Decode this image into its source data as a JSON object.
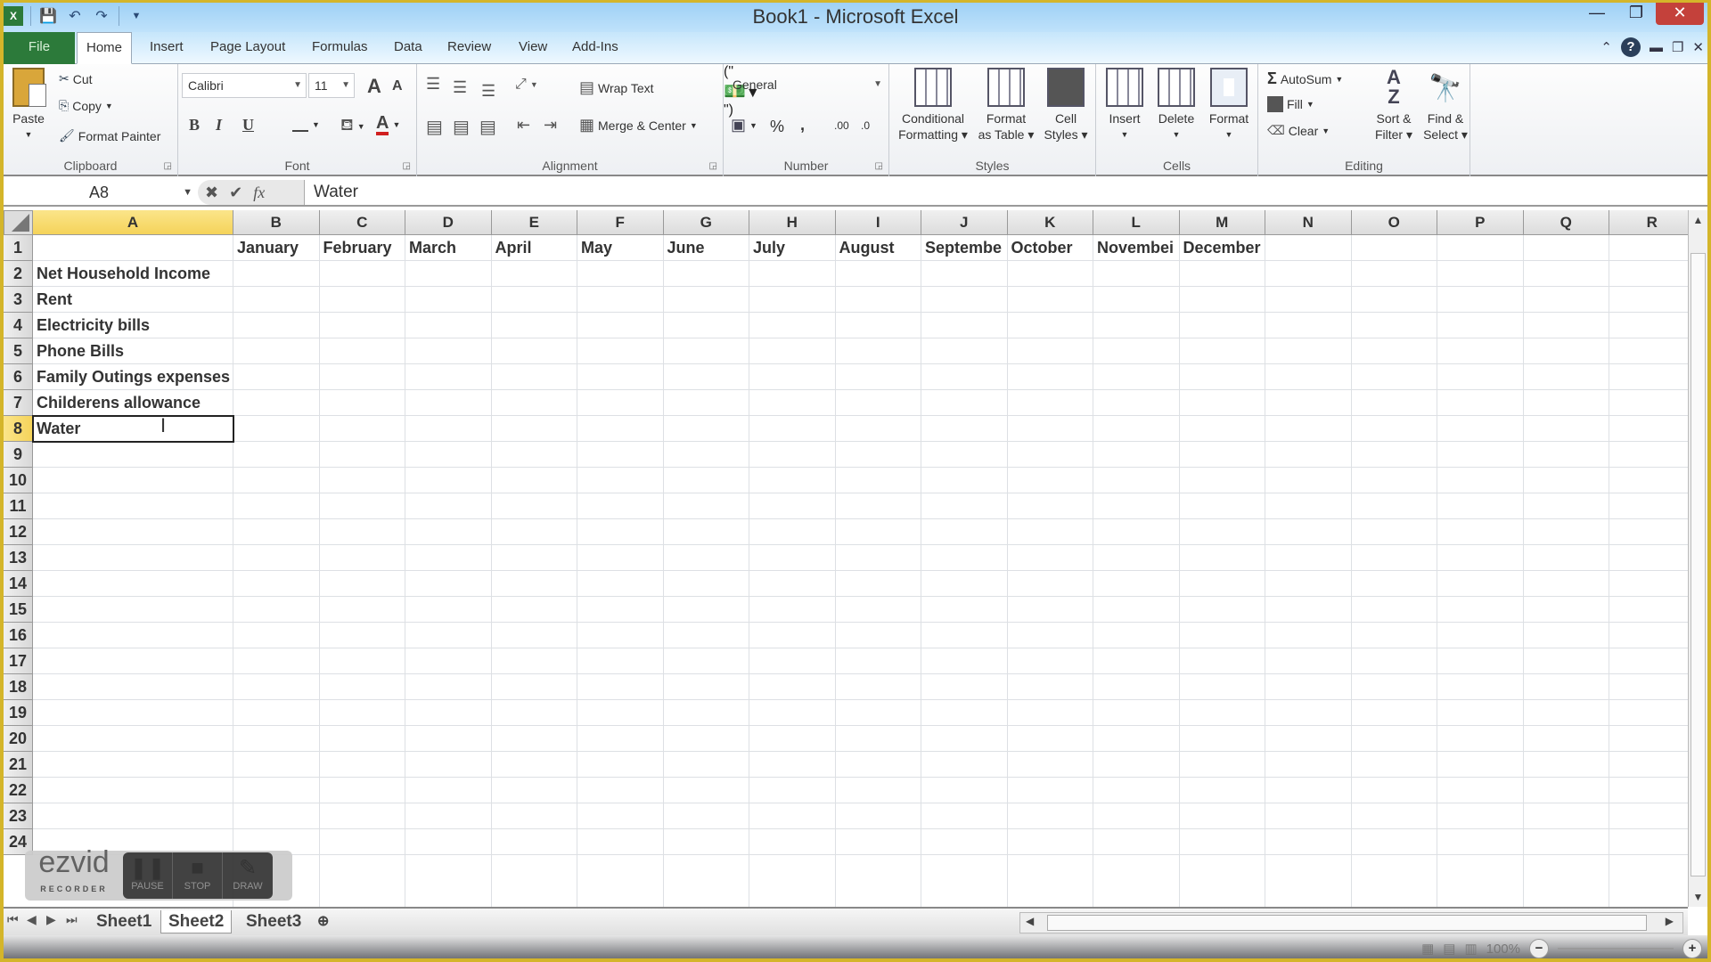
{
  "window": {
    "title": "Book1 - Microsoft Excel",
    "controls": {
      "minimize": "—",
      "restore": "❐",
      "close": "✕"
    }
  },
  "quick_access": {
    "icons": [
      "excel-logo-icon",
      "save-icon",
      "undo-icon",
      "redo-icon",
      "customize-qat-icon"
    ]
  },
  "ribbon_tabs": [
    {
      "label": "File"
    },
    {
      "label": "Home",
      "active": true
    },
    {
      "label": "Insert"
    },
    {
      "label": "Page Layout"
    },
    {
      "label": "Formulas"
    },
    {
      "label": "Data"
    },
    {
      "label": "Review"
    },
    {
      "label": "View"
    },
    {
      "label": "Add-Ins"
    }
  ],
  "ribbon": {
    "clipboard": {
      "label": "Clipboard",
      "paste": "Paste",
      "cut": "Cut",
      "copy": "Copy",
      "format_painter": "Format Painter"
    },
    "font": {
      "label": "Font",
      "font_name": "Calibri",
      "font_size": "11",
      "bold": "B",
      "italic": "I",
      "underline": "U",
      "grow": "A",
      "shrink": "A",
      "font_color_accent": "#d02020"
    },
    "alignment": {
      "label": "Alignment",
      "wrap_text": "Wrap Text",
      "merge_center": "Merge & Center"
    },
    "number": {
      "label": "Number",
      "format": "General",
      "percent": "%",
      "comma": ",",
      "inc_decimal": ".00",
      "dec_decimal": ".0"
    },
    "styles": {
      "label": "Styles",
      "conditional_formatting": [
        "Conditional",
        "Formatting"
      ],
      "format_as_table": [
        "Format",
        "as Table"
      ],
      "cell_styles": [
        "Cell",
        "Styles"
      ]
    },
    "cells": {
      "label": "Cells",
      "insert": "Insert",
      "delete": "Delete",
      "format": "Format"
    },
    "editing": {
      "label": "Editing",
      "autosum": "AutoSum",
      "fill": "Fill",
      "clear": "Clear",
      "sort_filter": [
        "Sort &",
        "Filter"
      ],
      "find_select": [
        "Find &",
        "Select"
      ]
    }
  },
  "formula_bar": {
    "name_box": "A8",
    "fx": "fx",
    "value": "Water"
  },
  "sheet": {
    "columns": [
      "A",
      "B",
      "C",
      "D",
      "E",
      "F",
      "G",
      "H",
      "I",
      "J",
      "K",
      "L",
      "M",
      "N",
      "O",
      "P",
      "Q",
      "R"
    ],
    "selected_column": "A",
    "rows": [
      "1",
      "2",
      "3",
      "4",
      "5",
      "6",
      "7",
      "8",
      "9",
      "10",
      "11",
      "12",
      "13",
      "14",
      "15",
      "16",
      "17",
      "18",
      "19",
      "20",
      "21",
      "22",
      "23",
      "24"
    ],
    "selected_row": "8",
    "row1_months": [
      "January",
      "February",
      "March",
      "April",
      "May",
      "June",
      "July",
      "August",
      "Septembe",
      "October",
      "Novembei",
      "December"
    ],
    "column_a": [
      "",
      "Net Household Income",
      "Rent",
      "Electricity bills",
      "Phone Bills",
      "Family Outings expenses",
      "Childerens allowance",
      "Water"
    ]
  },
  "sheet_tabs": [
    {
      "label": "Sheet1"
    },
    {
      "label": "Sheet2",
      "active": true
    },
    {
      "label": "Sheet3"
    }
  ],
  "status_bar": {
    "zoom": "100%"
  },
  "recorder_overlay": {
    "brand": "ezvid",
    "sub": "RECORDER",
    "buttons": [
      "PAUSE",
      "STOP",
      "DRAW"
    ]
  }
}
